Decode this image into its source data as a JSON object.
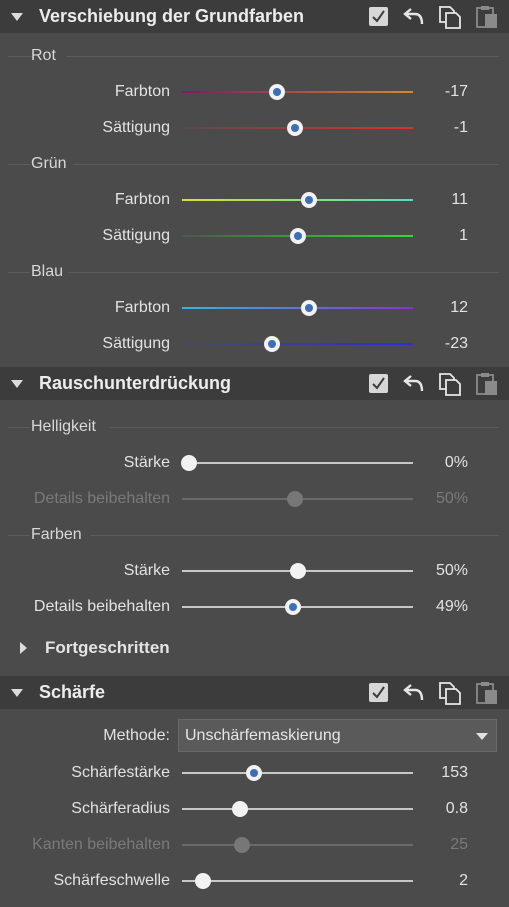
{
  "sections": [
    {
      "title": "Verschiebung der Grundfarben"
    },
    {
      "title": "Rauschunterdrückung"
    },
    {
      "title": "Schärfe"
    }
  ],
  "groups": {
    "rot": "Rot",
    "gruen": "Grün",
    "blau": "Blau",
    "helligkeit": "Helligkeit",
    "farben": "Farben"
  },
  "sliders": [
    {
      "label": "Farbton",
      "value": "-17",
      "fraction": 0.41,
      "enabled": true,
      "gradient": [
        "#7a1a6a",
        "#d9862a"
      ]
    },
    {
      "label": "Sättigung",
      "value": "-1",
      "fraction": 0.49,
      "enabled": true,
      "gradient": [
        "#5a4a4a",
        "#e0302a"
      ]
    },
    {
      "label": "Farbton",
      "value": "11",
      "fraction": 0.55,
      "enabled": true,
      "gradient": [
        "#d8e02a",
        "#4ee0c0"
      ]
    },
    {
      "label": "Sättigung",
      "value": "1",
      "fraction": 0.5,
      "enabled": true,
      "gradient": [
        "#4a5a4a",
        "#2ae02a"
      ]
    },
    {
      "label": "Farbton",
      "value": "12",
      "fraction": 0.55,
      "enabled": true,
      "gradient": [
        "#30b8e0",
        "#8a30d8"
      ]
    },
    {
      "label": "Sättigung",
      "value": "-23",
      "fraction": 0.39,
      "enabled": true,
      "gradient": [
        "#4a4a5a",
        "#2a30e0"
      ]
    },
    {
      "label": "Stärke",
      "value": "0%",
      "fraction": 0.03,
      "enabled": true
    },
    {
      "label": "Details beibehalten",
      "value": "50%",
      "fraction": 0.49,
      "enabled": false
    },
    {
      "label": "Stärke",
      "value": "50%",
      "fraction": 0.5,
      "enabled": true
    },
    {
      "label": "Details beibehalten",
      "value": "49%",
      "fraction": 0.48,
      "enabled": true
    },
    {
      "label": "Schärfestärke",
      "value": "153",
      "fraction": 0.31,
      "enabled": true
    },
    {
      "label": "Schärferadius",
      "value": "0.8",
      "fraction": 0.25,
      "enabled": true
    },
    {
      "label": "Kanten beibehalten",
      "value": "25",
      "fraction": 0.26,
      "enabled": false
    },
    {
      "label": "Schärfeschwelle",
      "value": "2",
      "fraction": 0.09,
      "enabled": true
    }
  ],
  "advanced": {
    "label": "Fortgeschritten"
  },
  "method": {
    "label": "Methode:",
    "value": "Unschärfemaskierung"
  },
  "icons": {
    "collapse": "triangle-down-icon",
    "enable": "checkbox-icon",
    "reset": "undo-icon",
    "copy": "copy-icon",
    "paste": "paste-icon"
  }
}
